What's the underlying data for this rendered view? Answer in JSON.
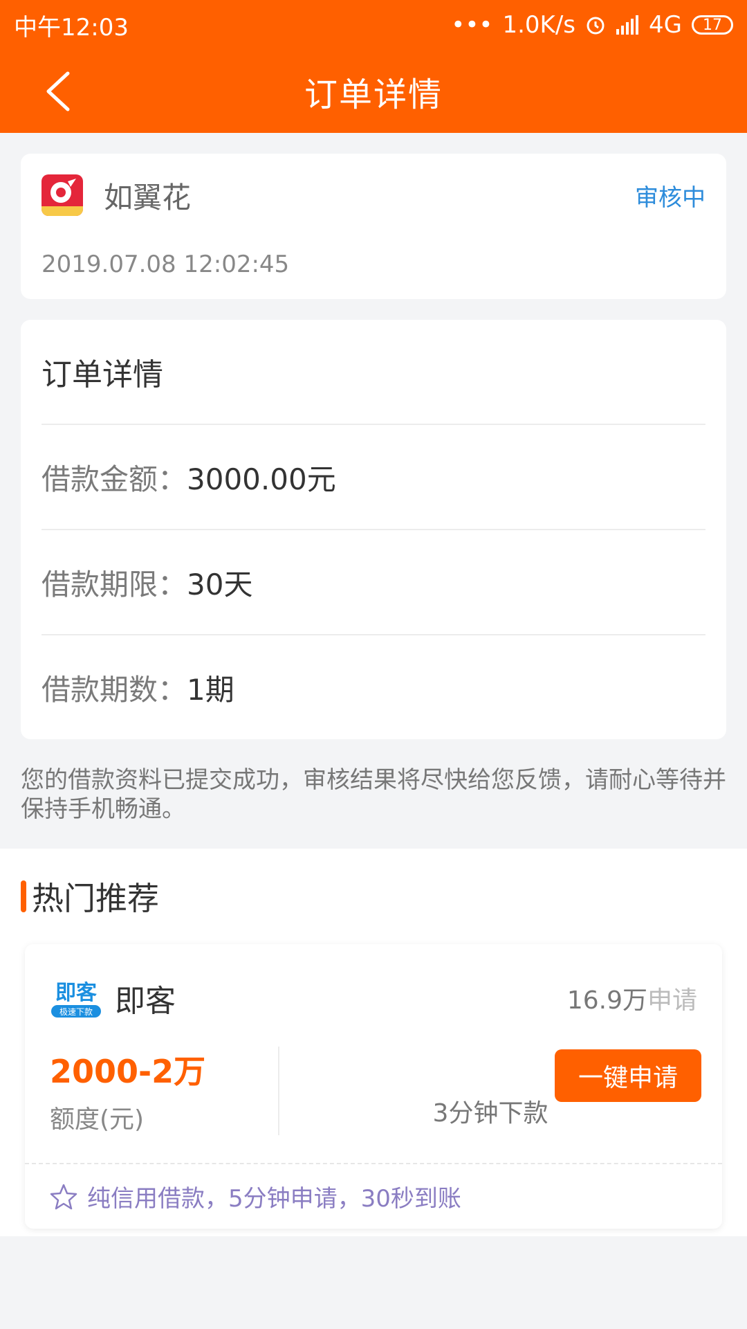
{
  "status_bar": {
    "time": "中午12:03",
    "dots": "•••",
    "speed": "1.0K/s",
    "network": "4G",
    "battery": "17"
  },
  "nav": {
    "title": "订单详情"
  },
  "merchant": {
    "name": "如翼花",
    "status": "审核中",
    "time": "2019.07.08 12:02:45",
    "logo_text": "如翼花"
  },
  "details": {
    "header": "订单详情",
    "rows": [
      {
        "label": "借款金额：",
        "value": "3000.00元"
      },
      {
        "label": "借款期限：",
        "value": "30天"
      },
      {
        "label": "借款期数：",
        "value": "1期"
      }
    ]
  },
  "notice": "您的借款资料已提交成功，审核结果将尽快给您反馈，请耐心等待并保持手机畅通。",
  "recommend": {
    "title": "热门推荐",
    "product": {
      "name": "即客",
      "logo_top": "即客",
      "logo_sub": "极速下款",
      "apply_count": "16.9万",
      "apply_suffix": "申请",
      "amount": "2000-2万",
      "amount_label": "额度(元)",
      "speed": "3分钟下款",
      "apply_button": "一键申请",
      "tagline": "纯信用借款，5分钟申请，30秒到账"
    }
  },
  "colors": {
    "brand": "#ff6000",
    "status_blue": "#2d8cdb",
    "tagline_purple": "#8a7dc2"
  }
}
